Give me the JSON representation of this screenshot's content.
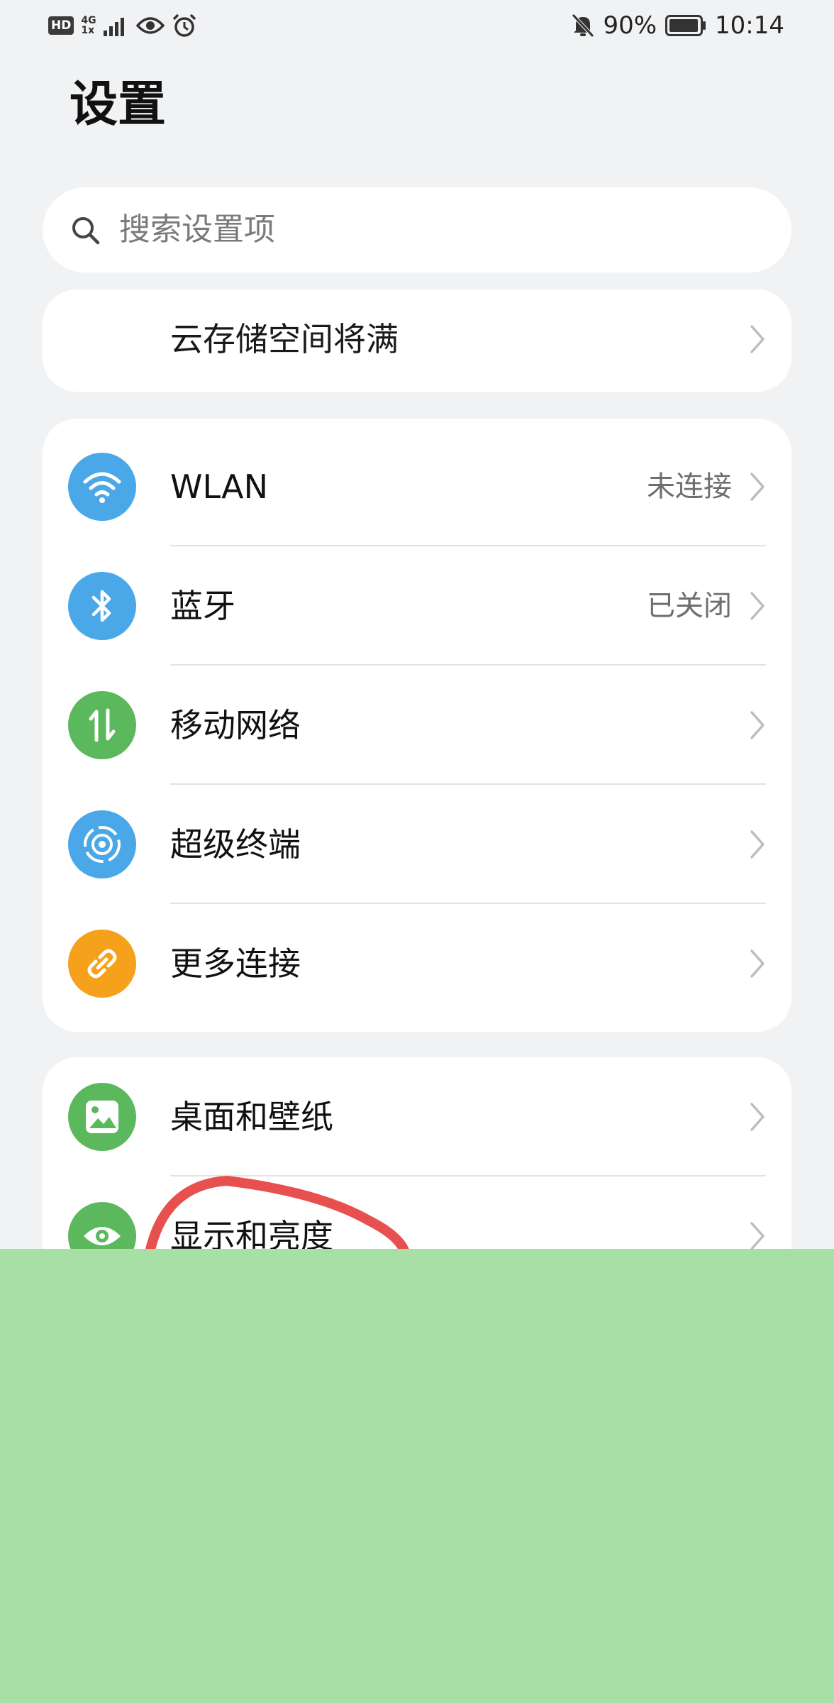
{
  "status_bar": {
    "hd": "HD",
    "network": "4G",
    "network_sub": "1x",
    "icons": [
      "hd-icon",
      "signal-icon",
      "eye-icon",
      "alarm-icon",
      "mute-icon",
      "battery-icon"
    ],
    "battery": "90%",
    "time": "10:14"
  },
  "header": {
    "title": "设置"
  },
  "search": {
    "placeholder": "搜索设置项"
  },
  "cloud_banner": {
    "label": "云存储空间将满"
  },
  "connectivity": [
    {
      "label": "WLAN",
      "value": "未连接",
      "icon": "wifi-icon",
      "color": "#4aa8e8"
    },
    {
      "label": "蓝牙",
      "value": "已关闭",
      "icon": "bluetooth-icon",
      "color": "#4aa8e8"
    },
    {
      "label": "移动网络",
      "value": "",
      "icon": "mobile-data-icon",
      "color": "#5cb85c"
    },
    {
      "label": "超级终端",
      "value": "",
      "icon": "super-device-icon",
      "color": "#4aa8e8"
    },
    {
      "label": "更多连接",
      "value": "",
      "icon": "link-icon",
      "color": "#f6a11c"
    }
  ],
  "display": [
    {
      "label": "桌面和壁纸",
      "icon": "wallpaper-icon",
      "color": "#5cb85c"
    },
    {
      "label": "显示和亮度",
      "icon": "eye-icon",
      "color": "#5cb85c"
    }
  ],
  "colors": {
    "overlay": "#a8dfa5",
    "annotation": "#e85050",
    "background": "#f1f2f4"
  }
}
